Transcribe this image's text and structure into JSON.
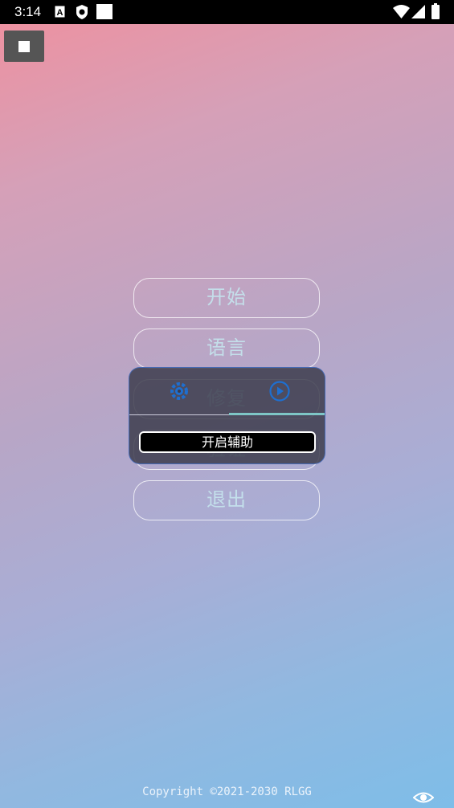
{
  "status_bar": {
    "time": "3:14",
    "left_icons": [
      "font-a-icon",
      "shield-app-icon",
      "blank-square-icon"
    ],
    "right_icons": [
      "wifi-icon",
      "signal-icon",
      "battery-icon"
    ]
  },
  "stop_button": {
    "icon": "stop-icon"
  },
  "menu": {
    "items": [
      {
        "label": "开始"
      },
      {
        "label": "语言"
      },
      {
        "label": "修复"
      },
      {
        "label": "验证"
      },
      {
        "label": "退出"
      }
    ]
  },
  "overlay": {
    "icons": [
      "gear-icon",
      "play-icon"
    ],
    "button_label": "开启辅助",
    "accent_color": "#1e6fd0"
  },
  "footer": {
    "copyright": "Copyright ©2021-2030 RLGG",
    "icon": "eye-icon"
  },
  "colors": {
    "gradient_top": "#f0909e",
    "gradient_bottom": "#7ebde8",
    "menu_text": "#c4e2ec"
  }
}
